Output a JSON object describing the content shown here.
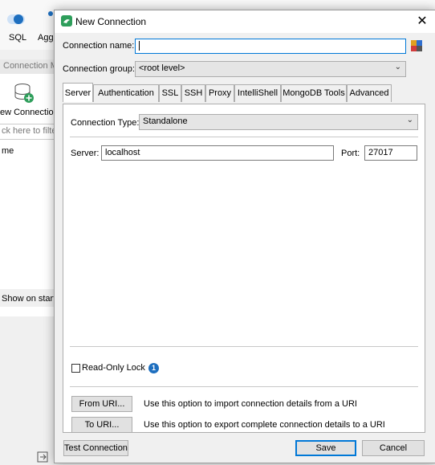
{
  "background_app": {
    "toolbar": {
      "sql_label": "SQL",
      "agg_label": "Agg"
    },
    "connection_manager_tab": "Connection M",
    "new_connection_label": "ew Connection",
    "filter_placeholder": "ck here to filte",
    "name_column": "me",
    "show_on_startup": "Show on startu"
  },
  "dialog": {
    "title": "New Connection",
    "connection_name_label": "Connection name:",
    "connection_name_value": "",
    "connection_group_label": "Connection group:",
    "connection_group_value": "<root level>",
    "tabs": [
      {
        "label": "Server",
        "active": true
      },
      {
        "label": "Authentication"
      },
      {
        "label": "SSL"
      },
      {
        "label": "SSH"
      },
      {
        "label": "Proxy"
      },
      {
        "label": "IntelliShell"
      },
      {
        "label": "MongoDB Tools"
      },
      {
        "label": "Advanced"
      }
    ],
    "server_tab": {
      "connection_type_label": "Connection Type:",
      "connection_type_value": "Standalone",
      "server_label": "Server:",
      "server_value": "localhost",
      "port_label": "Port:",
      "port_value": "27017",
      "read_only_lock_label": "Read-Only Lock",
      "read_only_lock_checked": false,
      "info_badge": "1",
      "from_uri_button": "From URI...",
      "from_uri_description": "Use this option to import connection details from a URI",
      "to_uri_button": "To URI...",
      "to_uri_description": "Use this option to export complete connection details to a URI"
    },
    "footer": {
      "test_connection_button": "Test Connection",
      "save_button": "Save",
      "cancel_button": "Cancel"
    }
  },
  "colors": {
    "accent": "#0078d7",
    "info_badge": "#1e6fbf",
    "app_logo": "#2e9e5b"
  }
}
